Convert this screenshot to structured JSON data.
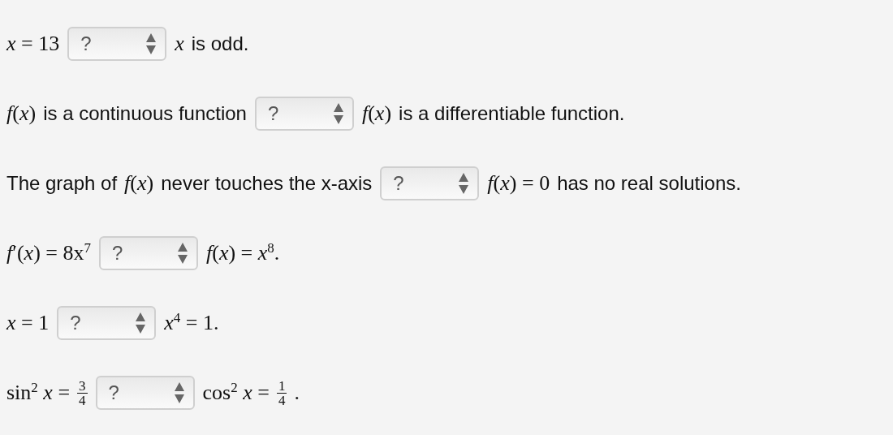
{
  "rows": [
    {
      "left": [
        {
          "kind": "math",
          "text": "*x* = 13"
        }
      ],
      "select": {
        "value": "?"
      },
      "right": [
        {
          "kind": "math",
          "text": "*x*"
        },
        {
          "kind": "text",
          "text": "is odd."
        }
      ]
    },
    {
      "left": [
        {
          "kind": "math",
          "text": "*f*(*x*)"
        },
        {
          "kind": "text",
          "text": "is a continuous function"
        }
      ],
      "select": {
        "value": "?"
      },
      "right": [
        {
          "kind": "math",
          "text": "*f*(*x*)"
        },
        {
          "kind": "text",
          "text": "is a differentiable function."
        }
      ]
    },
    {
      "left": [
        {
          "kind": "text",
          "text": "The graph of"
        },
        {
          "kind": "math",
          "text": "*f*(*x*)"
        },
        {
          "kind": "text",
          "text": "never touches the x-axis"
        }
      ],
      "select": {
        "value": "?"
      },
      "right": [
        {
          "kind": "math",
          "text": "*f*(*x*) = 0"
        },
        {
          "kind": "text",
          "text": "has no real solutions."
        }
      ]
    },
    {
      "left": [
        {
          "kind": "math",
          "text": "*f*′(*x*) = 8x$^{7}$"
        }
      ],
      "select": {
        "value": "?"
      },
      "right": [
        {
          "kind": "math",
          "text": "*f*(*x*) = *x*$^{8}$."
        }
      ]
    },
    {
      "left": [
        {
          "kind": "math",
          "text": "*x* = 1"
        }
      ],
      "select": {
        "value": "?"
      },
      "right": [
        {
          "kind": "math",
          "text": "*x*$^{4}$ = 1."
        }
      ]
    },
    {
      "left": [
        {
          "kind": "math",
          "text": "sin$^{2}$ *x* ="
        },
        {
          "kind": "frac",
          "num": "3",
          "den": "4"
        }
      ],
      "select": {
        "value": "?"
      },
      "right": [
        {
          "kind": "math",
          "text": "cos$^{2}$ *x* ="
        },
        {
          "kind": "frac",
          "num": "1",
          "den": "4"
        },
        {
          "kind": "math",
          "text": "."
        }
      ]
    }
  ]
}
